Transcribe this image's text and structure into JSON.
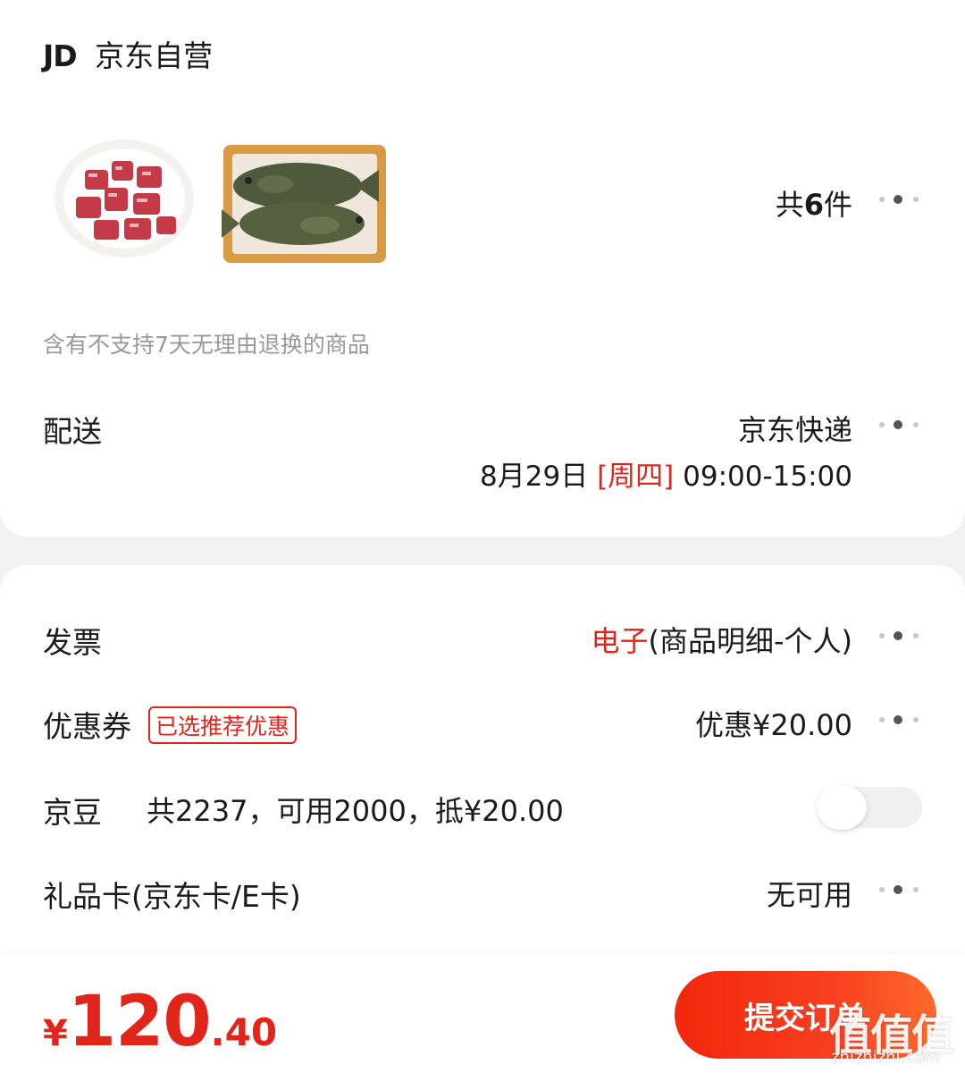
{
  "store": {
    "logo_text": "JD",
    "name": "京东自营"
  },
  "items": {
    "count_prefix": "共",
    "count": "6",
    "count_suffix": "件",
    "products": [
      {
        "icon": "diced-meat-image"
      },
      {
        "icon": "grilled-fish-image"
      }
    ],
    "notice": "含有不支持7天无理由退换的商品"
  },
  "delivery": {
    "label": "配送",
    "method": "京东快递",
    "date": "8月29日",
    "weekday": "[周四]",
    "time_window": "09:00-15:00"
  },
  "invoice": {
    "label": "发票",
    "type": "电子",
    "detail": "(商品明细-个人)"
  },
  "coupon": {
    "label": "优惠券",
    "badge": "已选推荐优惠",
    "value": "优惠¥20.00"
  },
  "jingdou": {
    "label": "京豆",
    "detail": "共2237，可用2000，抵¥20.00",
    "toggle_on": false
  },
  "gift_card": {
    "label": "礼品卡(京东卡/E卡)",
    "value": "无可用"
  },
  "footer": {
    "currency": "¥",
    "price_int": "120",
    "price_dec": ".40",
    "submit_label": "提交订单"
  },
  "watermark": {
    "logo": "值值值",
    "url": "zhizhizhi.com"
  },
  "colors": {
    "accent": "#e1251b",
    "background": "#f2f2f2"
  }
}
